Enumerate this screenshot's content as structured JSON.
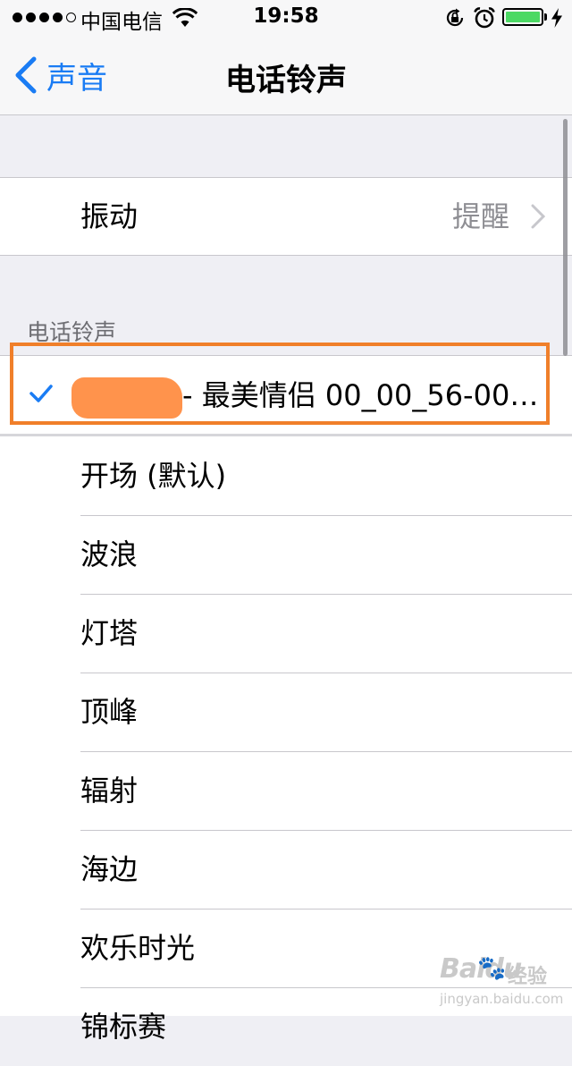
{
  "status_bar": {
    "carrier": "中国电信",
    "time": "19:58",
    "signal_bars": 5,
    "signal_filled": 4,
    "battery_level": 1.0,
    "battery_color": "#4cd964"
  },
  "nav": {
    "back_label": "声音",
    "title": "电话铃声",
    "accent_color": "#1a7cf4"
  },
  "vibration": {
    "label": "振动",
    "value": "提醒"
  },
  "ringtone_section": {
    "header": "电话铃声",
    "selected": {
      "label": "- 最美情侣 00_00_56-00…",
      "checked": true,
      "redacted_prefix": true
    },
    "items": [
      "开场 (默认)",
      "波浪",
      "灯塔",
      "顶峰",
      "辐射",
      "海边",
      "欢乐时光",
      "锦标赛"
    ]
  },
  "watermark": {
    "logo_text": "Baidu",
    "cn_text": "经验",
    "subtitle": "jingyan.baidu.com"
  }
}
